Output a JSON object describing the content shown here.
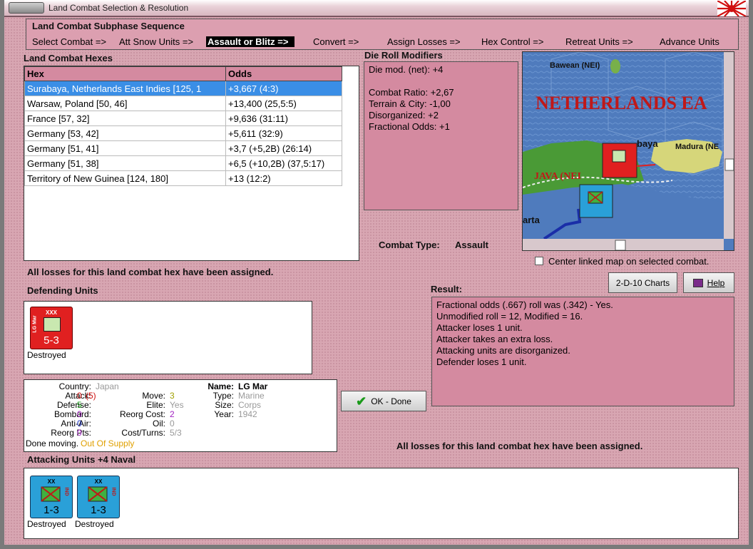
{
  "window": {
    "title": "Land Combat Selection & Resolution"
  },
  "subphase": {
    "title": "Land Combat Subphase Sequence",
    "steps": [
      "Select Combat =>",
      "Att Snow Units =>",
      "Assault or Blitz =>",
      "Convert =>",
      "Assign Losses =>",
      "Hex Control =>",
      "Retreat Units =>",
      "Advance Units"
    ],
    "active": "Assault or Blitz =>"
  },
  "hexes": {
    "title": "Land Combat Hexes",
    "col_hex": "Hex",
    "col_odds": "Odds",
    "rows": [
      {
        "hex": "Surabaya, Netherlands East Indies [125, 1",
        "odds": "+3,667 (4:3)"
      },
      {
        "hex": "Warsaw, Poland [50, 46]",
        "odds": "+13,400 (25,5:5)"
      },
      {
        "hex": "France [57, 32]",
        "odds": "+9,636 (31:11)"
      },
      {
        "hex": "Germany [53, 42]",
        "odds": "+5,611 (32:9)"
      },
      {
        "hex": "Germany [51, 41]",
        "odds": "+3,7 (+5,2B) (26:14)"
      },
      {
        "hex": "Germany [51, 38]",
        "odds": "+6,5 (+10,2B) (37,5:17)"
      },
      {
        "hex": "Territory of New Guinea [124, 180]",
        "odds": "+13 (12:2)"
      }
    ]
  },
  "drm": {
    "title": "Die Roll Modifiers",
    "lines": [
      "Die mod. (net): +4",
      "",
      "Combat Ratio: +2,67",
      "Terrain & City: -1,00",
      "Disorganized: +2",
      "Fractional Odds: +1"
    ]
  },
  "combat_type": {
    "label": "Combat Type:",
    "value": "Assault"
  },
  "map": {
    "labels": [
      "Bawean (NEI)",
      "NETHERLANDS EA",
      "baya",
      "Madura (NE",
      "JAVA (NEI",
      "arta"
    ]
  },
  "center_linked": "Center linked map on selected combat.",
  "losses_msg_top": "All losses for this land combat hex have been assigned.",
  "losses_msg_bottom": "All losses for this land combat hex have been assigned.",
  "buttons": {
    "charts": "2-D-10 Charts",
    "help": "Help",
    "ok": "OK - Done"
  },
  "defending": {
    "title": "Defending Units",
    "units": [
      {
        "type": "XXX",
        "name": "LG Mar",
        "strength": "5-3",
        "status": "Destroyed",
        "color": "#e02020"
      }
    ]
  },
  "result": {
    "title": "Result:",
    "lines": [
      "Fractional odds (.667) roll was (.342)  - Yes.",
      "Unmodified roll = 12, Modified = 16.",
      "Attacker loses 1 unit.",
      "Attacker takes an extra loss.",
      "Attacking units are disorganized.",
      "Defender loses 1 unit."
    ]
  },
  "unit_info": {
    "country_l": "Country:",
    "country": "Japan",
    "attack_l": "Attack:",
    "attack": "0",
    "attack_base": "(5)",
    "defense_l": "Defense:",
    "defense": "5",
    "bombard_l": "Bombard:",
    "bombard": "0",
    "antiair_l": "Anti-Air:",
    "antiair": "0",
    "reorgpts_l": "Reorg Pts:",
    "reorgpts": "0",
    "done_l": "Done moving.",
    "supply": "Out Of Supply",
    "move_l": "Move:",
    "move": "3",
    "elite_l": "Elite:",
    "elite": "Yes",
    "reorgcost_l": "Reorg Cost:",
    "reorgcost": "2",
    "oil_l": "Oil:",
    "oil": "0",
    "costturns_l": "Cost/Turns:",
    "costturns": "5/3",
    "name_l": "Name:",
    "name": "LG Mar",
    "type_l": "Type:",
    "type": "Marine",
    "size_l": "Size:",
    "size": "Corps",
    "year_l": "Year:",
    "year": "1942"
  },
  "attacking": {
    "title": "Attacking Units +4 Naval",
    "units": [
      {
        "type": "XX",
        "nation": "IND",
        "strength": "1-3",
        "status": "Destroyed",
        "color": "#2aa0d8"
      },
      {
        "type": "XX",
        "nation": "IND",
        "strength": "1-3",
        "status": "Destroyed",
        "color": "#2aa0d8"
      }
    ]
  }
}
